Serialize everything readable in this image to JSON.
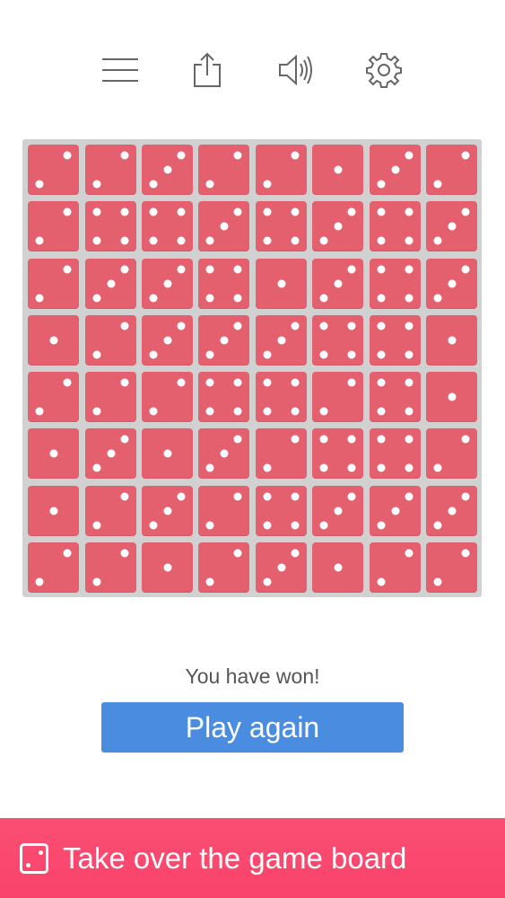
{
  "toolbar": {
    "icons": [
      "menu-icon",
      "share-icon",
      "sound-icon",
      "settings-icon"
    ]
  },
  "board": {
    "rows": 8,
    "cols": 8,
    "die_color": "#e4606f",
    "pip_color": "#ffffff",
    "values": [
      [
        2,
        2,
        3,
        2,
        2,
        1,
        3,
        2
      ],
      [
        2,
        4,
        4,
        3,
        4,
        3,
        4,
        3
      ],
      [
        2,
        3,
        3,
        4,
        1,
        3,
        4,
        3
      ],
      [
        1,
        2,
        3,
        3,
        3,
        4,
        4,
        1
      ],
      [
        2,
        2,
        2,
        4,
        4,
        2,
        4,
        1
      ],
      [
        1,
        3,
        1,
        3,
        2,
        4,
        4,
        2
      ],
      [
        1,
        2,
        3,
        2,
        4,
        3,
        3,
        3
      ],
      [
        2,
        2,
        1,
        2,
        3,
        1,
        2,
        2
      ]
    ]
  },
  "status": {
    "message": "You have won!"
  },
  "play_again": {
    "label": "Play again",
    "color": "#4a8de0"
  },
  "banner": {
    "label": "Take over the game board",
    "color": "#fb4e72"
  }
}
